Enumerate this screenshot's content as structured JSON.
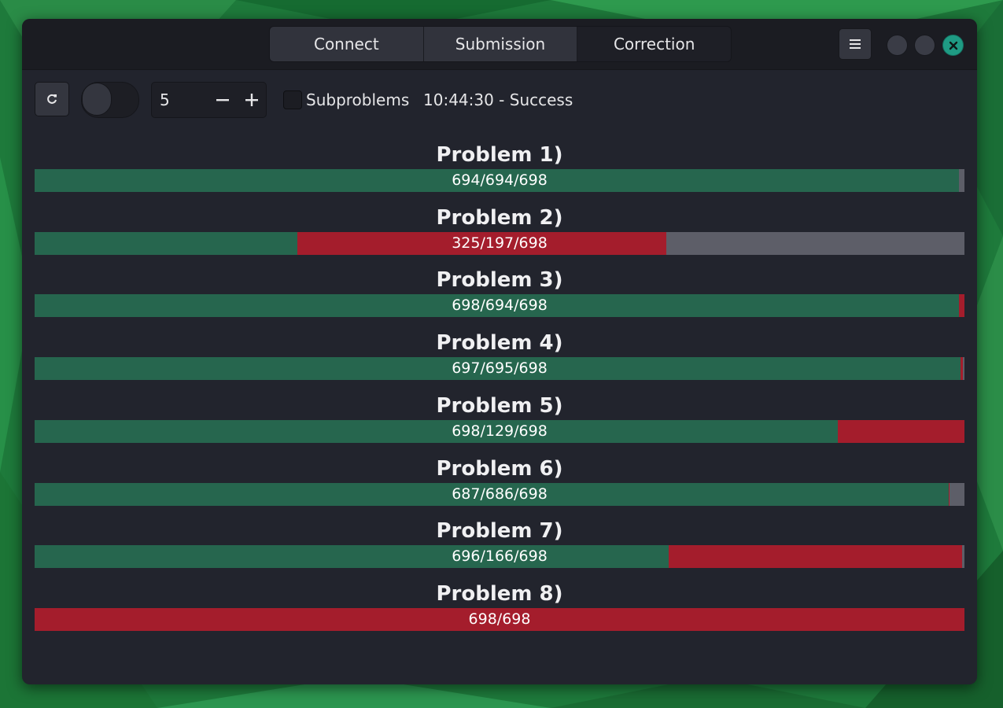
{
  "tabs": [
    {
      "label": "Connect",
      "active": false
    },
    {
      "label": "Submission",
      "active": false
    },
    {
      "label": "Correction",
      "active": true
    }
  ],
  "toolbar": {
    "spin_value": "5",
    "subproblems_label": "Subproblems",
    "status": "10:44:30 - Success"
  },
  "colors": {
    "ok": "#26664e",
    "fail": "#a41d2c",
    "pending": "#5d5e68",
    "close": "#1f9b84"
  },
  "problems": [
    {
      "title": "Problem 1)",
      "label": "694/694/698",
      "submitted": 694,
      "correct": 694,
      "total": 698,
      "failed_first": false
    },
    {
      "title": "Problem 2)",
      "label": "325/197/698",
      "submitted": 474,
      "correct": 197,
      "total": 698,
      "failed_first": false
    },
    {
      "title": "Problem 3)",
      "label": "698/694/698",
      "submitted": 698,
      "correct": 694,
      "total": 698,
      "failed_first": false
    },
    {
      "title": "Problem 4)",
      "label": "697/695/698",
      "submitted": 697,
      "correct": 695,
      "total": 698,
      "failed_first": false
    },
    {
      "title": "Problem 5)",
      "label": "698/129/698",
      "submitted": 698,
      "correct": 603,
      "total": 698,
      "failed_first": false
    },
    {
      "title": "Problem 6)",
      "label": "687/686/698",
      "submitted": 687,
      "correct": 686,
      "total": 698,
      "failed_first": false
    },
    {
      "title": "Problem 7)",
      "label": "696/166/698",
      "submitted": 696,
      "correct": 476,
      "total": 698,
      "failed_first": false
    },
    {
      "title": "Problem 8)",
      "label": "698/698",
      "submitted": 698,
      "correct": 0,
      "total": 698,
      "failed_first": true
    }
  ]
}
